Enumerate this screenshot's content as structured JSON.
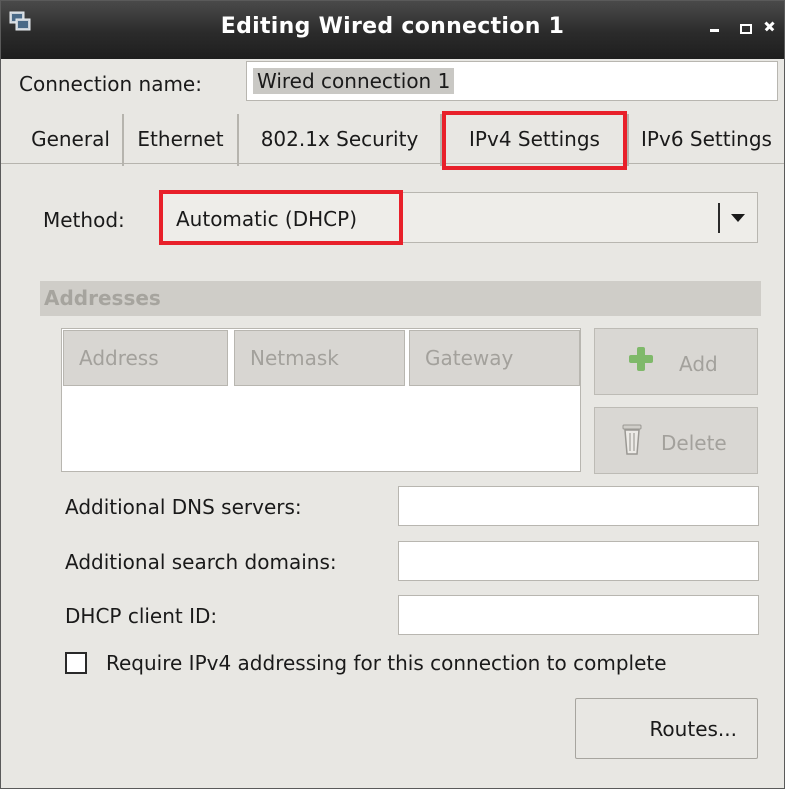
{
  "window": {
    "title": "Editing Wired connection 1",
    "icon": "network-connection-icon",
    "controls": [
      "minimize",
      "maximize",
      "close"
    ]
  },
  "connection": {
    "label": "Connection name:",
    "value": "Wired connection 1"
  },
  "tabs": [
    {
      "label": "General"
    },
    {
      "label": "Ethernet"
    },
    {
      "label": "802.1x Security"
    },
    {
      "label": "IPv4 Settings",
      "active": true
    },
    {
      "label": "IPv6 Settings"
    }
  ],
  "method": {
    "label": "Method:",
    "value": "Automatic (DHCP)"
  },
  "addresses": {
    "header": "Addresses",
    "columns": [
      "Address",
      "Netmask",
      "Gateway"
    ],
    "add_label": "Add",
    "delete_label": "Delete"
  },
  "fields": {
    "dns_label": "Additional DNS servers:",
    "dns_value": "",
    "search_label": "Additional search domains:",
    "search_value": "",
    "dhcp_label": "DHCP client ID:",
    "dhcp_value": ""
  },
  "require_ipv4": {
    "label": "Require IPv4 addressing for this connection to complete",
    "checked": false
  },
  "routes_label": "Routes...",
  "annotation_color": "#e8202a"
}
